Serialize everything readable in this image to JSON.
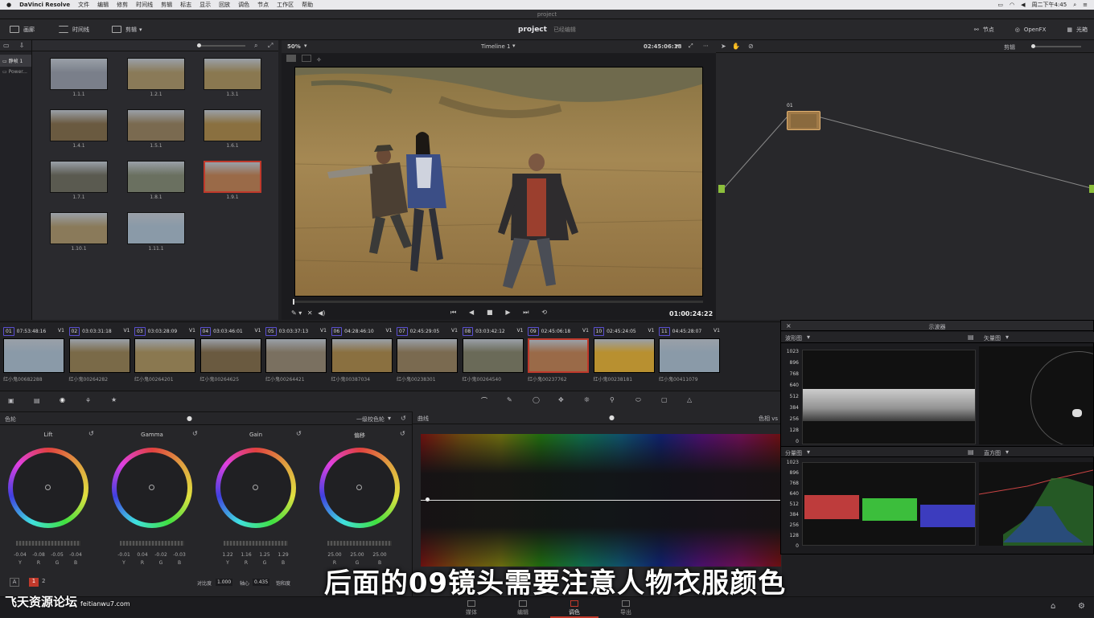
{
  "menubar": {
    "app": "DaVinci Resolve",
    "items": [
      "文件",
      "编辑",
      "修剪",
      "时间线",
      "剪辑",
      "标志",
      "显示",
      "回放",
      "调色",
      "节点",
      "工作区",
      "帮助"
    ],
    "clock": "周二下午4:45"
  },
  "window": {
    "title": "project"
  },
  "toolbar": {
    "gallery": "画廊",
    "timelines": "时间线",
    "clips": "剪辑",
    "project": "project",
    "status": "已经编辑",
    "nodes": "节点",
    "openfx": "OpenFX",
    "lightbox": "光箱"
  },
  "leftcol": {
    "items": [
      "静帧 1",
      "Power..."
    ]
  },
  "gallery_stills": [
    "1.1.1",
    "1.2.1",
    "1.3.1",
    "1.4.1",
    "1.5.1",
    "1.6.1",
    "1.7.1",
    "1.8.1",
    "1.9.1",
    "1.10.1",
    "1.11.1"
  ],
  "viewer": {
    "zoom": "50%",
    "timeline": "Timeline 1",
    "timecode_top": "02:45:06:18",
    "timecode": "01:00:24:22"
  },
  "node": {
    "label": "01"
  },
  "nodes_mode": "剪辑",
  "clips": [
    {
      "idx": "01",
      "tc": "07:53:48:16",
      "track": "V1",
      "name": "红小鬼00682288"
    },
    {
      "idx": "02",
      "tc": "03:03:31:18",
      "track": "V1",
      "name": "红小鬼00264282"
    },
    {
      "idx": "03",
      "tc": "03:03:28:09",
      "track": "V1",
      "name": "红小鬼00264201"
    },
    {
      "idx": "04",
      "tc": "03:03:46:01",
      "track": "V1",
      "name": "红小鬼00264625"
    },
    {
      "idx": "05",
      "tc": "03:03:37:13",
      "track": "V1",
      "name": "红小鬼00264421"
    },
    {
      "idx": "06",
      "tc": "04:28:46:10",
      "track": "V1",
      "name": "红小鬼00387034"
    },
    {
      "idx": "07",
      "tc": "02:45:29:05",
      "track": "V1",
      "name": "红小鬼00238301"
    },
    {
      "idx": "08",
      "tc": "03:03:42:12",
      "track": "V1",
      "name": "红小鬼00264540"
    },
    {
      "idx": "09",
      "tc": "02:45:06:18",
      "track": "V1",
      "name": "红小鬼00237762"
    },
    {
      "idx": "10",
      "tc": "02:45:24:05",
      "track": "V1",
      "name": "红小鬼00238181"
    },
    {
      "idx": "11",
      "tc": "04:45:28:07",
      "track": "V1",
      "name": "红小鬼00411079"
    }
  ],
  "wheels": {
    "title": "色轮",
    "mode": "一级校色轮",
    "items": [
      {
        "label": "Lift",
        "vals": [
          "-0.04",
          "-0.08",
          "-0.05",
          "-0.04"
        ],
        "ch": [
          "Y",
          "R",
          "G",
          "B"
        ]
      },
      {
        "label": "Gamma",
        "vals": [
          "-0.01",
          "0.04",
          "-0.02",
          "-0.03"
        ],
        "ch": [
          "Y",
          "R",
          "G",
          "B"
        ]
      },
      {
        "label": "Gain",
        "vals": [
          "1.22",
          "1.16",
          "1.25",
          "1.29"
        ],
        "ch": [
          "Y",
          "R",
          "G",
          "B"
        ]
      },
      {
        "label": "偏移",
        "vals": [
          "25.00",
          "25.00",
          "25.00"
        ],
        "ch": [
          "R",
          "G",
          "B"
        ]
      }
    ],
    "contrast_label": "对比度",
    "contrast": "1.000",
    "pivot_label": "轴心",
    "pivot": "0.435",
    "sat_label": "饱和度",
    "page_a": "A",
    "page_1": "1",
    "page_2": "2"
  },
  "curves": {
    "title": "曲线",
    "mode": "色相 vs"
  },
  "scopes": {
    "title": "示波器",
    "waveform": "波形图",
    "vectorscope": "矢量图",
    "parade": "分量图",
    "histogram": "直方图",
    "ticks": [
      "1023",
      "896",
      "768",
      "640",
      "512",
      "384",
      "256",
      "128",
      "0"
    ]
  },
  "pages": [
    "媒体",
    "编辑",
    "调色",
    "导出"
  ],
  "subtitle": "后面的09镜头需要注意人物衣服颜色",
  "watermark": {
    "text": "飞天资源论坛",
    "url": "feitianwu7.com"
  }
}
